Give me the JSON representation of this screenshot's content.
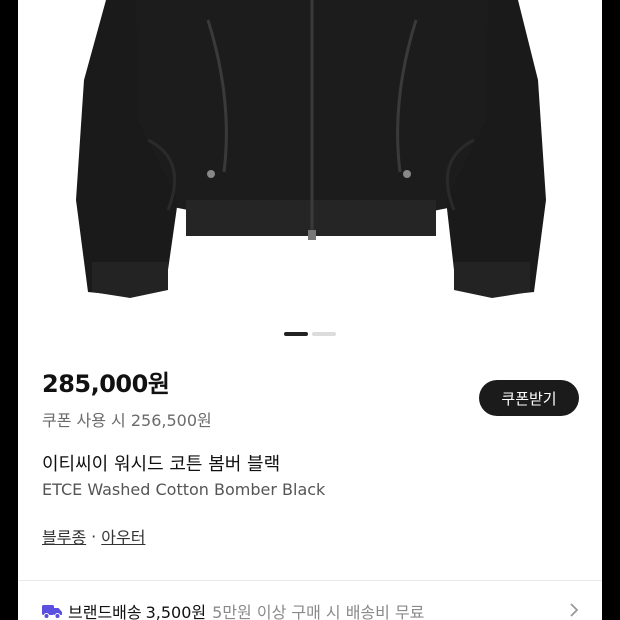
{
  "product": {
    "price": "285,000원",
    "coupon_price": "쿠폰 사용 시 256,500원",
    "coupon_button": "쿠폰받기",
    "name_ko": "이티씨이 워시드 코튼 봄버 블랙",
    "name_en": "ETCE Washed Cotton Bomber Black"
  },
  "category": {
    "primary": "블루종",
    "separator": "·",
    "secondary": "아우터"
  },
  "shipping": {
    "icon": "truck-icon",
    "label": "브랜드배송",
    "fee": "3,500원",
    "note": "5만원 이상 구매 시 배송비 무료",
    "icon_color": "#5b4fe0"
  },
  "carousel": {
    "current": 1,
    "total": 2
  }
}
